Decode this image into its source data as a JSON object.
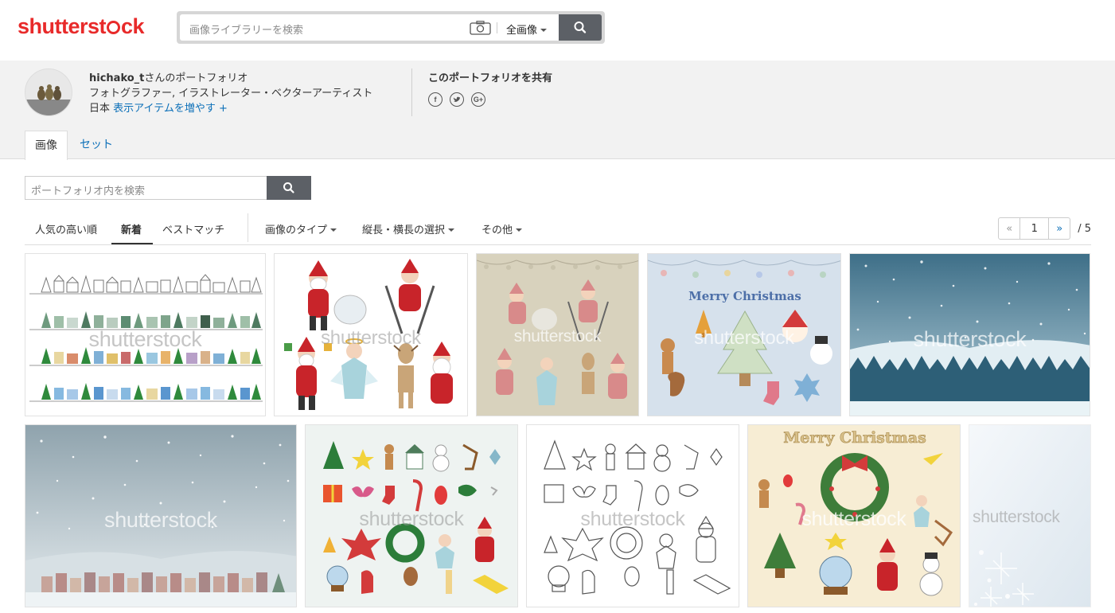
{
  "header": {
    "logo": "shutterstock",
    "search_placeholder": "画像ライブラリーを検索",
    "media_type": "全画像",
    "icons": {
      "camera": "camera-icon",
      "search": "search-icon"
    },
    "brand_color": "#e82a2a"
  },
  "profile": {
    "username": "hichako_t",
    "name_suffix": "さんのポートフォリオ",
    "role": "フォトグラファー, イラストレーター・ベクターアーティスト",
    "country": "日本",
    "more_link": "表示アイテムを増やす +",
    "share_title": "このポートフォリオを共有",
    "share_icons": [
      "facebook-icon",
      "twitter-icon",
      "google-plus-icon"
    ]
  },
  "tabs": [
    {
      "label": "画像",
      "active": true
    },
    {
      "label": "セット",
      "active": false
    }
  ],
  "portfolio_search": {
    "placeholder": "ポートフォリオ内を検索"
  },
  "sort": {
    "options": [
      "人気の高い順",
      "新着",
      "ベストマッチ"
    ],
    "active": "新着"
  },
  "filters": [
    "画像のタイプ",
    "縦長・横長の選択",
    "その他"
  ],
  "pagination": {
    "prev": "«",
    "current": "1",
    "next": "»",
    "total": "/ 5"
  },
  "watermark": "shutterstock",
  "thumbnails": [
    {
      "subject": "houses-rows"
    },
    {
      "subject": "santa-characters"
    },
    {
      "subject": "santa-characters-beige"
    },
    {
      "subject": "merry-christmas-cookies",
      "text": "Merry Christmas"
    },
    {
      "subject": "snowy-forest"
    },
    {
      "subject": "snowy-village"
    },
    {
      "subject": "christmas-icons-color"
    },
    {
      "subject": "christmas-icons-outline"
    },
    {
      "subject": "merry-christmas-wreath",
      "text": "Merry Christmas"
    },
    {
      "subject": "snow-crystal"
    }
  ]
}
